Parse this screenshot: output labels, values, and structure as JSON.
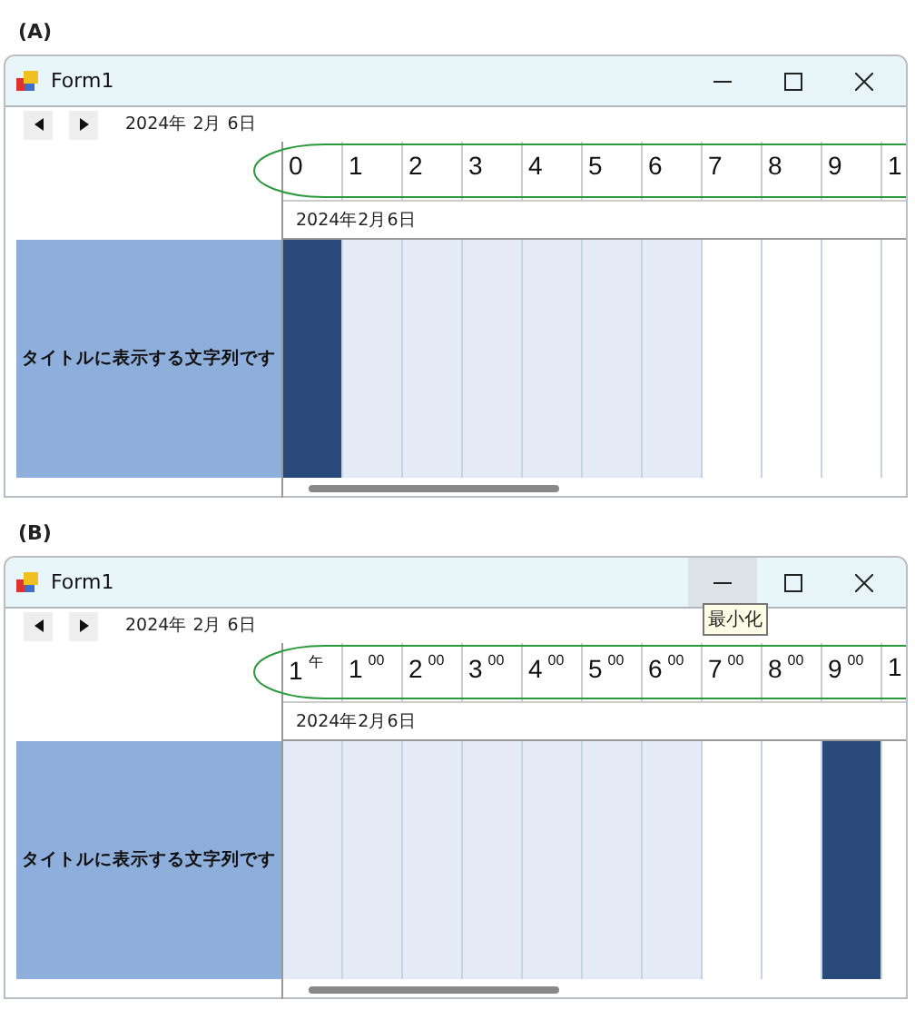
{
  "panels": [
    {
      "label": "(A)",
      "window": {
        "title": "Form1",
        "minimize_hovered": false
      },
      "toolbar": {
        "date": "2024年 2月 6日"
      },
      "hours": [
        {
          "label": "0",
          "kind": "selected"
        },
        {
          "label": "1",
          "kind": "shaded"
        },
        {
          "label": "2",
          "kind": "shaded"
        },
        {
          "label": "3",
          "kind": "shaded"
        },
        {
          "label": "4",
          "kind": "shaded"
        },
        {
          "label": "5",
          "kind": "shaded"
        },
        {
          "label": "6",
          "kind": "shaded"
        },
        {
          "label": "7",
          "kind": "plain"
        },
        {
          "label": "8",
          "kind": "plain"
        },
        {
          "label": "9",
          "kind": "plain"
        },
        {
          "label": "1",
          "kind": "plain"
        }
      ],
      "day_label": "2024年2月6日",
      "row_title": "タイトルに表示する文字列です"
    },
    {
      "label": "(B)",
      "window": {
        "title": "Form1",
        "minimize_hovered": true,
        "tooltip": "最小化"
      },
      "toolbar": {
        "date": "2024年 2月 6日"
      },
      "hours": [
        {
          "label": "1",
          "sup": "午",
          "kind": "shaded"
        },
        {
          "label": "1",
          "sup": "00",
          "kind": "shaded"
        },
        {
          "label": "2",
          "sup": "00",
          "kind": "shaded"
        },
        {
          "label": "3",
          "sup": "00",
          "kind": "shaded"
        },
        {
          "label": "4",
          "sup": "00",
          "kind": "shaded"
        },
        {
          "label": "5",
          "sup": "00",
          "kind": "shaded"
        },
        {
          "label": "6",
          "sup": "00",
          "kind": "shaded"
        },
        {
          "label": "7",
          "sup": "00",
          "kind": "plain"
        },
        {
          "label": "8",
          "sup": "00",
          "kind": "plain"
        },
        {
          "label": "9",
          "sup": "00",
          "kind": "selected"
        },
        {
          "label": "1",
          "kind": "plain"
        }
      ],
      "day_label": "2024年2月6日",
      "row_title": "タイトルに表示する文字列です"
    }
  ]
}
